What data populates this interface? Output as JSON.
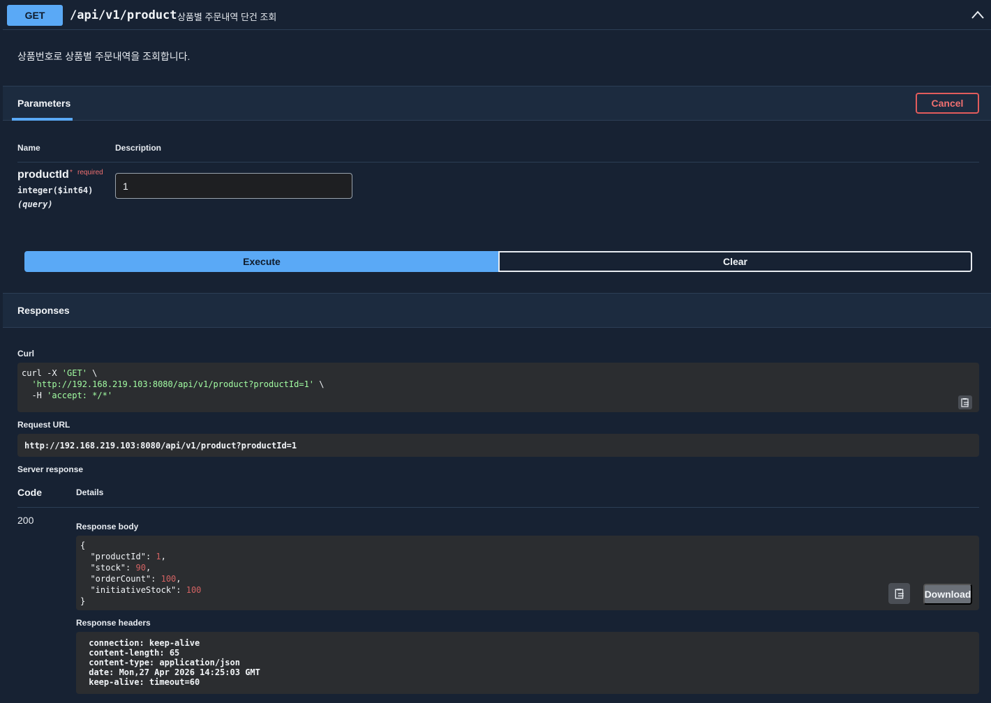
{
  "operation": {
    "method": "GET",
    "path": "/api/v1/product",
    "summary": "상품별 주문내역 단건 조회",
    "description": "상품번호로 상품별 주문내역을 조회합니다."
  },
  "parameters": {
    "tab_label": "Parameters",
    "cancel_label": "Cancel",
    "col_name": "Name",
    "col_description": "Description",
    "items": [
      {
        "name": "productId",
        "required_star": "*",
        "required_label": "required",
        "type": "integer($int64)",
        "in": "(query)",
        "value": "1"
      }
    ],
    "execute_label": "Execute",
    "clear_label": "Clear"
  },
  "responses": {
    "title": "Responses",
    "curl_label": "Curl",
    "curl": {
      "line1_cmd": "curl -X ",
      "line1_method": "'GET'",
      "line1_end": " \\",
      "line2_url": "'http://192.168.219.103:8080/api/v1/product?productId=1'",
      "line2_end": " \\",
      "line3_flag": "  -H ",
      "line3_header": "'accept: */*'"
    },
    "request_url_label": "Request URL",
    "request_url": "http://192.168.219.103:8080/api/v1/product?productId=1",
    "server_response_label": "Server response",
    "code_header": "Code",
    "details_header": "Details",
    "status_code": "200",
    "response_body_label": "Response body",
    "body": {
      "open": "{",
      "fields": [
        {
          "key": "\"productId\"",
          "value": "1",
          "comma": ","
        },
        {
          "key": "\"stock\"",
          "value": "90",
          "comma": ","
        },
        {
          "key": "\"orderCount\"",
          "value": "100",
          "comma": ","
        },
        {
          "key": "\"initiativeStock\"",
          "value": "100",
          "comma": ""
        }
      ],
      "close": "}"
    },
    "download_label": "Download",
    "response_headers_label": "Response headers",
    "headers": [
      " connection: keep-alive ",
      " content-length: 65 ",
      " content-type: application/json ",
      " date: Mon,27 Apr 2026 14:25:03 GMT ",
      " keep-alive: timeout=60 "
    ]
  },
  "colors": {
    "background": "#172233",
    "accent_blue": "#5aa9f6",
    "cancel_red": "#e25c5c",
    "code_bg": "#2b2d30",
    "string_green": "#a2fca2",
    "number_red": "#d36363"
  }
}
